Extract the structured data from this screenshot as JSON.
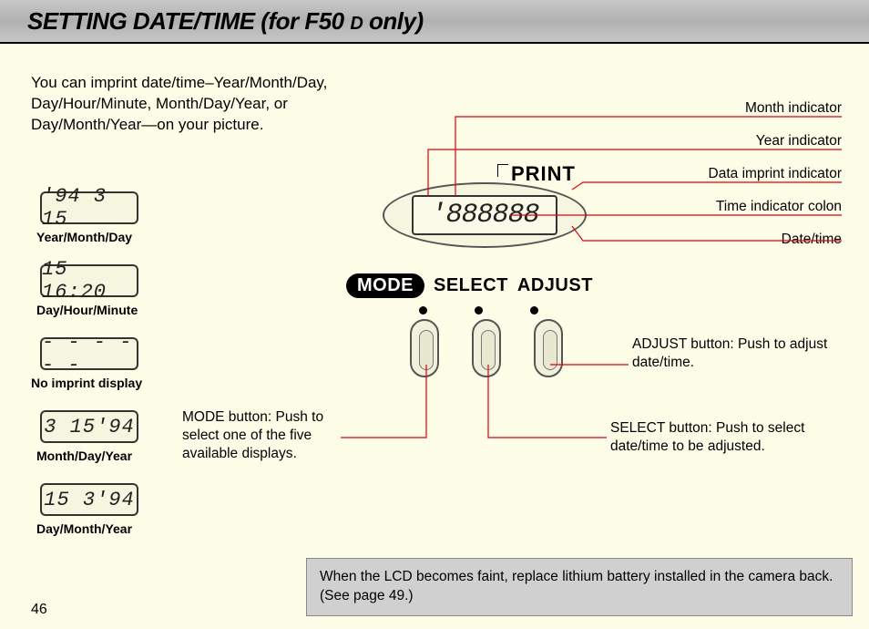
{
  "header": {
    "title_main": "SETTING DATE/TIME (for F50 ",
    "title_small": "D",
    "title_tail": " only)"
  },
  "intro": "You can imprint date/time–Year/Month/Day, Day/Hour/Minute, Month/Day/Year, or Day/Month/Year—on your picture.",
  "samples": [
    {
      "value": "'94  3 15",
      "label": "Year/Month/Day"
    },
    {
      "value": "15 16:20",
      "label": "Day/Hour/Minute"
    },
    {
      "value": "- - - - - -",
      "label": "No imprint display"
    },
    {
      "value": " 3 15'94",
      "label": "Month/Day/Year"
    },
    {
      "value": "15  3'94",
      "label": "Day/Month/Year"
    }
  ],
  "diagram": {
    "print_label": "PRINT",
    "lcd_digits": "'888888",
    "buttons": {
      "mode": "MODE",
      "select": "SELECT",
      "adjust": "ADJUST"
    }
  },
  "callouts_right": {
    "month": "Month indicator",
    "year": "Year indicator",
    "data_imprint": "Data imprint indicator",
    "colon": "Time indicator colon",
    "datetime": "Date/time"
  },
  "callouts_body": {
    "mode": "MODE button: Push to select one of the five available displays.",
    "select": "SELECT button: Push to select date/time to be adjusted.",
    "adjust": "ADJUST button: Push to adjust date/time."
  },
  "note": "When the LCD becomes faint, replace lithium battery installed in the camera back. (See page 49.)",
  "page": "46"
}
